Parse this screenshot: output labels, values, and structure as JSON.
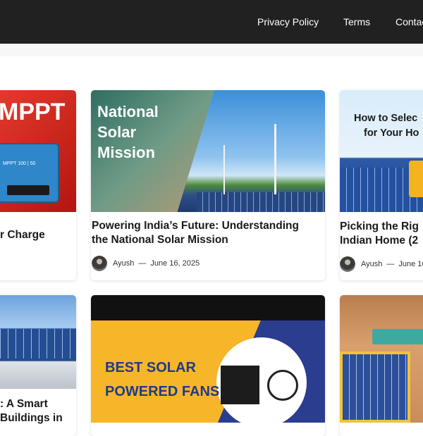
{
  "nav": {
    "items": [
      {
        "label": "Privacy Policy"
      },
      {
        "label": "Terms"
      },
      {
        "label": "Contac"
      }
    ]
  },
  "cards": [
    {
      "title_lines": [
        "r Charge"
      ],
      "image_text": "MPPT",
      "image_subtext": "MPPT 100 | 50"
    },
    {
      "title_lines": [
        "Powering India’s Future: Understanding",
        "the National Solar Mission"
      ],
      "image_text_lines": [
        "National",
        "Solar",
        "Mission"
      ],
      "author": "Ayush",
      "date": "June 16, 2025"
    },
    {
      "title_lines": [
        "Picking the Rig",
        "Indian Home (2"
      ],
      "image_text_lines": [
        "How to Selec",
        "for Your Ho"
      ],
      "author": "Ayush",
      "date": "June 16"
    },
    {
      "title_lines": [
        ": A Smart",
        "Buildings in"
      ]
    },
    {
      "image_text_lines": [
        "BEST SOLAR",
        "POWERED FANS"
      ]
    },
    {}
  ],
  "colors": {
    "topbar": "#212121",
    "fan_yellow": "#f7b52a",
    "fan_blue": "#2b3d8f",
    "mppt_red": "#d9251c"
  }
}
